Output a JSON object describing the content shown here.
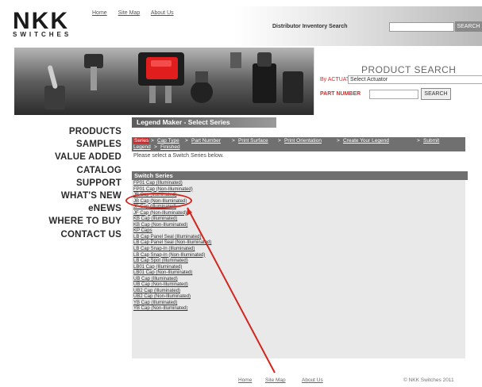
{
  "header": {
    "logo_main": "NKK",
    "logo_sub": "SWITCHES",
    "top_links": [
      "Home",
      "Site Map",
      "About Us"
    ],
    "distributor_label": "Distributor Inventory Search",
    "distributor_button": "SEARCH"
  },
  "product_search": {
    "title": "PRODUCT SEARCH",
    "actuation_label": "By ACTUATION",
    "actuation_value": "Select Actuator",
    "part_label": "PART NUMBER",
    "search_button": "SEARCH"
  },
  "nav": {
    "items": [
      "PRODUCTS",
      "SAMPLES",
      "VALUE ADDED",
      "CATALOG",
      "SUPPORT",
      "WHAT'S NEW",
      "eNEWS",
      "WHERE TO BUY",
      "CONTACT US"
    ]
  },
  "main": {
    "title": "Legend Maker - Select Series",
    "breadcrumb": {
      "active": "Series",
      "line1": [
        "Cap Type",
        "Part Number",
        "Print Surface",
        "Print Orientation",
        "Create Your Legend",
        "Submit"
      ],
      "line2": [
        "Legend",
        "Finished"
      ]
    },
    "instruction": "Please select a Switch Series below.",
    "series_header": "Switch Series",
    "series": [
      "FP01 Cap (Illuminated)",
      "FP01 Cap (Non-Illuminated)",
      "JB Cap (Illuminated)",
      "JB Cap (Non-Illuminated)",
      "JF Cap (Illuminated)",
      "JF Cap (Non-Illuminated)",
      "KB Cap (Illuminated)",
      "KB Cap (Non-Illuminated)",
      "KP Caps",
      "LB Cap Panel Seal (Illuminated)",
      "LB Cap Panel Seal (Non-Illuminated)",
      "LB Cap Snap-In (Illuminated)",
      "LB Cap Snap-In (Non-Illuminated)",
      "LB Cap Spot (Illuminated)",
      "LB01 Cap (Illuminated)",
      "LB01 Cap (Non-Illuminated)",
      "UB Cap (Illuminated)",
      "UB Cap (Non-Illuminated)",
      "UB2 Cap (Illuminated)",
      "UB2 Cap (Non-Illuminated)",
      "YB Cap (Illuminated)",
      "YB Cap (Non-Illuminated)"
    ]
  },
  "footer": {
    "links": [
      "Home",
      "Site Map",
      "About Us"
    ],
    "copyright": "© NKK Switches 2011"
  },
  "colors": {
    "annotation": "#d2261e",
    "breadcrumb_active": "#c62a2a",
    "nav_text": "#2a2a2a"
  }
}
